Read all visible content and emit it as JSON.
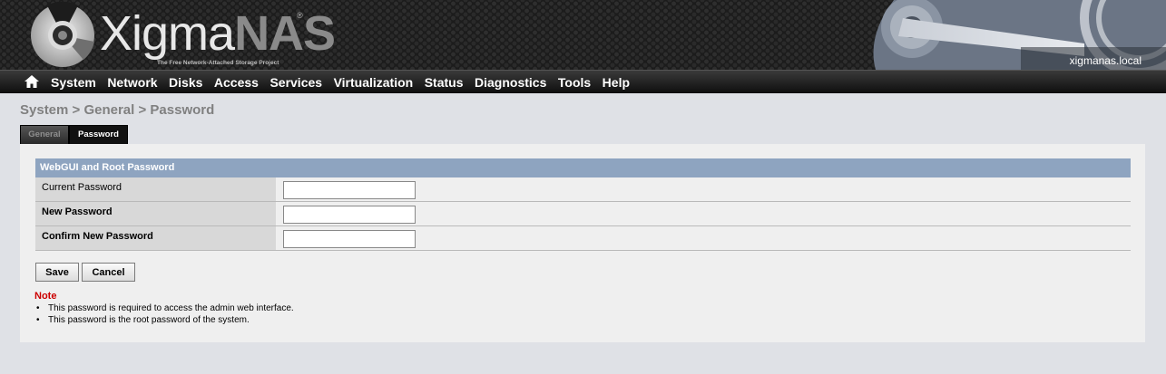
{
  "header": {
    "logo_main": "Xigma",
    "logo_accent": "NAS",
    "logo_registered": "®",
    "logo_tagline": "The Free Network-Attached Storage Project",
    "hostname": "xigmanas.local"
  },
  "nav": {
    "home_icon": "home-icon",
    "items": [
      {
        "label": "System"
      },
      {
        "label": "Network"
      },
      {
        "label": "Disks"
      },
      {
        "label": "Access"
      },
      {
        "label": "Services"
      },
      {
        "label": "Virtualization"
      },
      {
        "label": "Status"
      },
      {
        "label": "Diagnostics"
      },
      {
        "label": "Tools"
      },
      {
        "label": "Help"
      }
    ]
  },
  "breadcrumb": "System > General > Password",
  "tabs": [
    {
      "label": "General",
      "active": false
    },
    {
      "label": "Password",
      "active": true
    }
  ],
  "form": {
    "section_title": "WebGUI and Root Password",
    "fields": [
      {
        "label": "Current Password",
        "value": ""
      },
      {
        "label": "New Password",
        "value": ""
      },
      {
        "label": "Confirm New Password",
        "value": ""
      }
    ],
    "save_label": "Save",
    "cancel_label": "Cancel"
  },
  "note": {
    "title": "Note",
    "items": [
      "This password is required to access the admin web interface.",
      "This password is the root password of the system."
    ]
  },
  "colors": {
    "section_header": "#8ea4c0",
    "note_title": "#cc0000",
    "page_background": "#dfe1e6",
    "panel_background": "#efefef"
  }
}
